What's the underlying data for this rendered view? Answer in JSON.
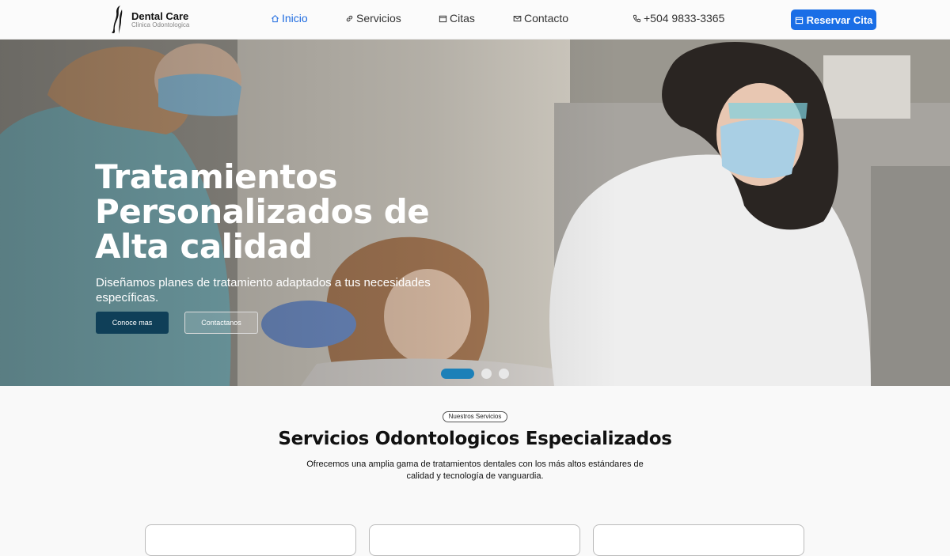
{
  "brand": {
    "name": "Dental Care",
    "subtitle": "Clinica Odontologica"
  },
  "nav": {
    "items": [
      {
        "label": "Inicio",
        "icon": "home-icon",
        "active": true
      },
      {
        "label": "Servicios",
        "icon": "link-icon"
      },
      {
        "label": "Citas",
        "icon": "calendar-icon"
      },
      {
        "label": "Contacto",
        "icon": "mail-icon"
      }
    ],
    "phone": "+504 9833-3365",
    "cta_label": "Reservar Cita"
  },
  "hero": {
    "title": "Tratamientos Personalizados de Alta calidad",
    "description": "Diseñamos planes de tratamiento adaptados a tus necesidades específicas.",
    "primary_button": "Conoce mas",
    "secondary_button": "Contactanos",
    "slides_total": 3,
    "active_slide": 1
  },
  "services": {
    "tag": "Nuestros Servicios",
    "title": "Servicios Odontologicos Especializados",
    "description": "Ofrecemos una amplia gama de tratamientos dentales con los más altos estándares de calidad y tecnología de vanguardia."
  },
  "colors": {
    "primary": "#1a6ee6",
    "dark_button": "#0f3f58",
    "active_dot": "#1c80b8"
  }
}
